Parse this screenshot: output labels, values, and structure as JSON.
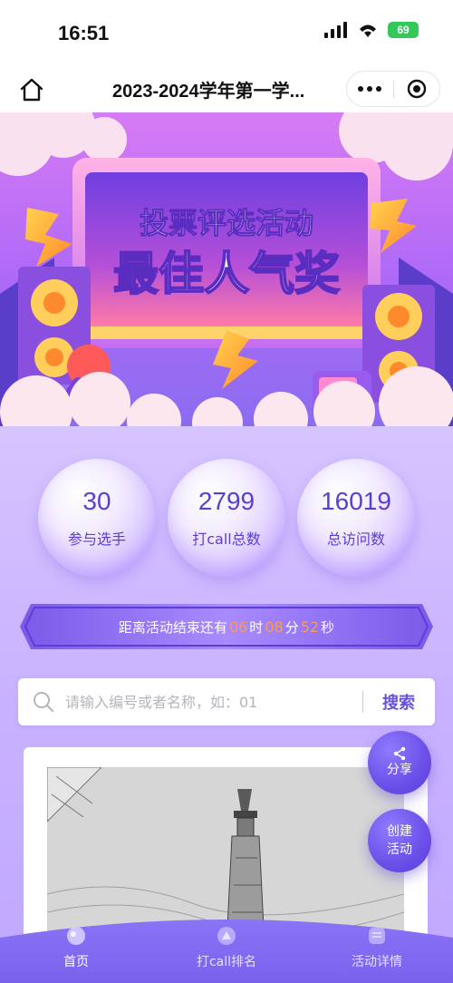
{
  "status_bar": {
    "time": "16:51",
    "battery": "69"
  },
  "nav": {
    "title": "2023-2024学年第一学..."
  },
  "banner": {
    "line1": "投票评选活动",
    "line2": "最佳人气奖"
  },
  "stats": [
    {
      "value": "30",
      "label": "参与选手"
    },
    {
      "value": "2799",
      "label": "打call总数"
    },
    {
      "value": "16019",
      "label": "总访问数"
    }
  ],
  "countdown": {
    "prefix": "距离活动结束还有",
    "hours": "06",
    "hours_unit": "时",
    "minutes": "08",
    "minutes_unit": "分",
    "seconds": "52",
    "seconds_unit": "秒"
  },
  "search": {
    "placeholder": "请输入编号或者名称，如：01",
    "button": "搜索"
  },
  "fab": {
    "share": "分享",
    "create_line1": "创建",
    "create_line2": "活动"
  },
  "tabs": [
    {
      "label": "首页",
      "active": true
    },
    {
      "label": "打call排名",
      "active": false
    },
    {
      "label": "活动详情",
      "active": false
    }
  ],
  "colors": {
    "accent": "#6a4fe0",
    "countdown_number": "#ff9a4d",
    "banner_text": "#ffffff"
  }
}
